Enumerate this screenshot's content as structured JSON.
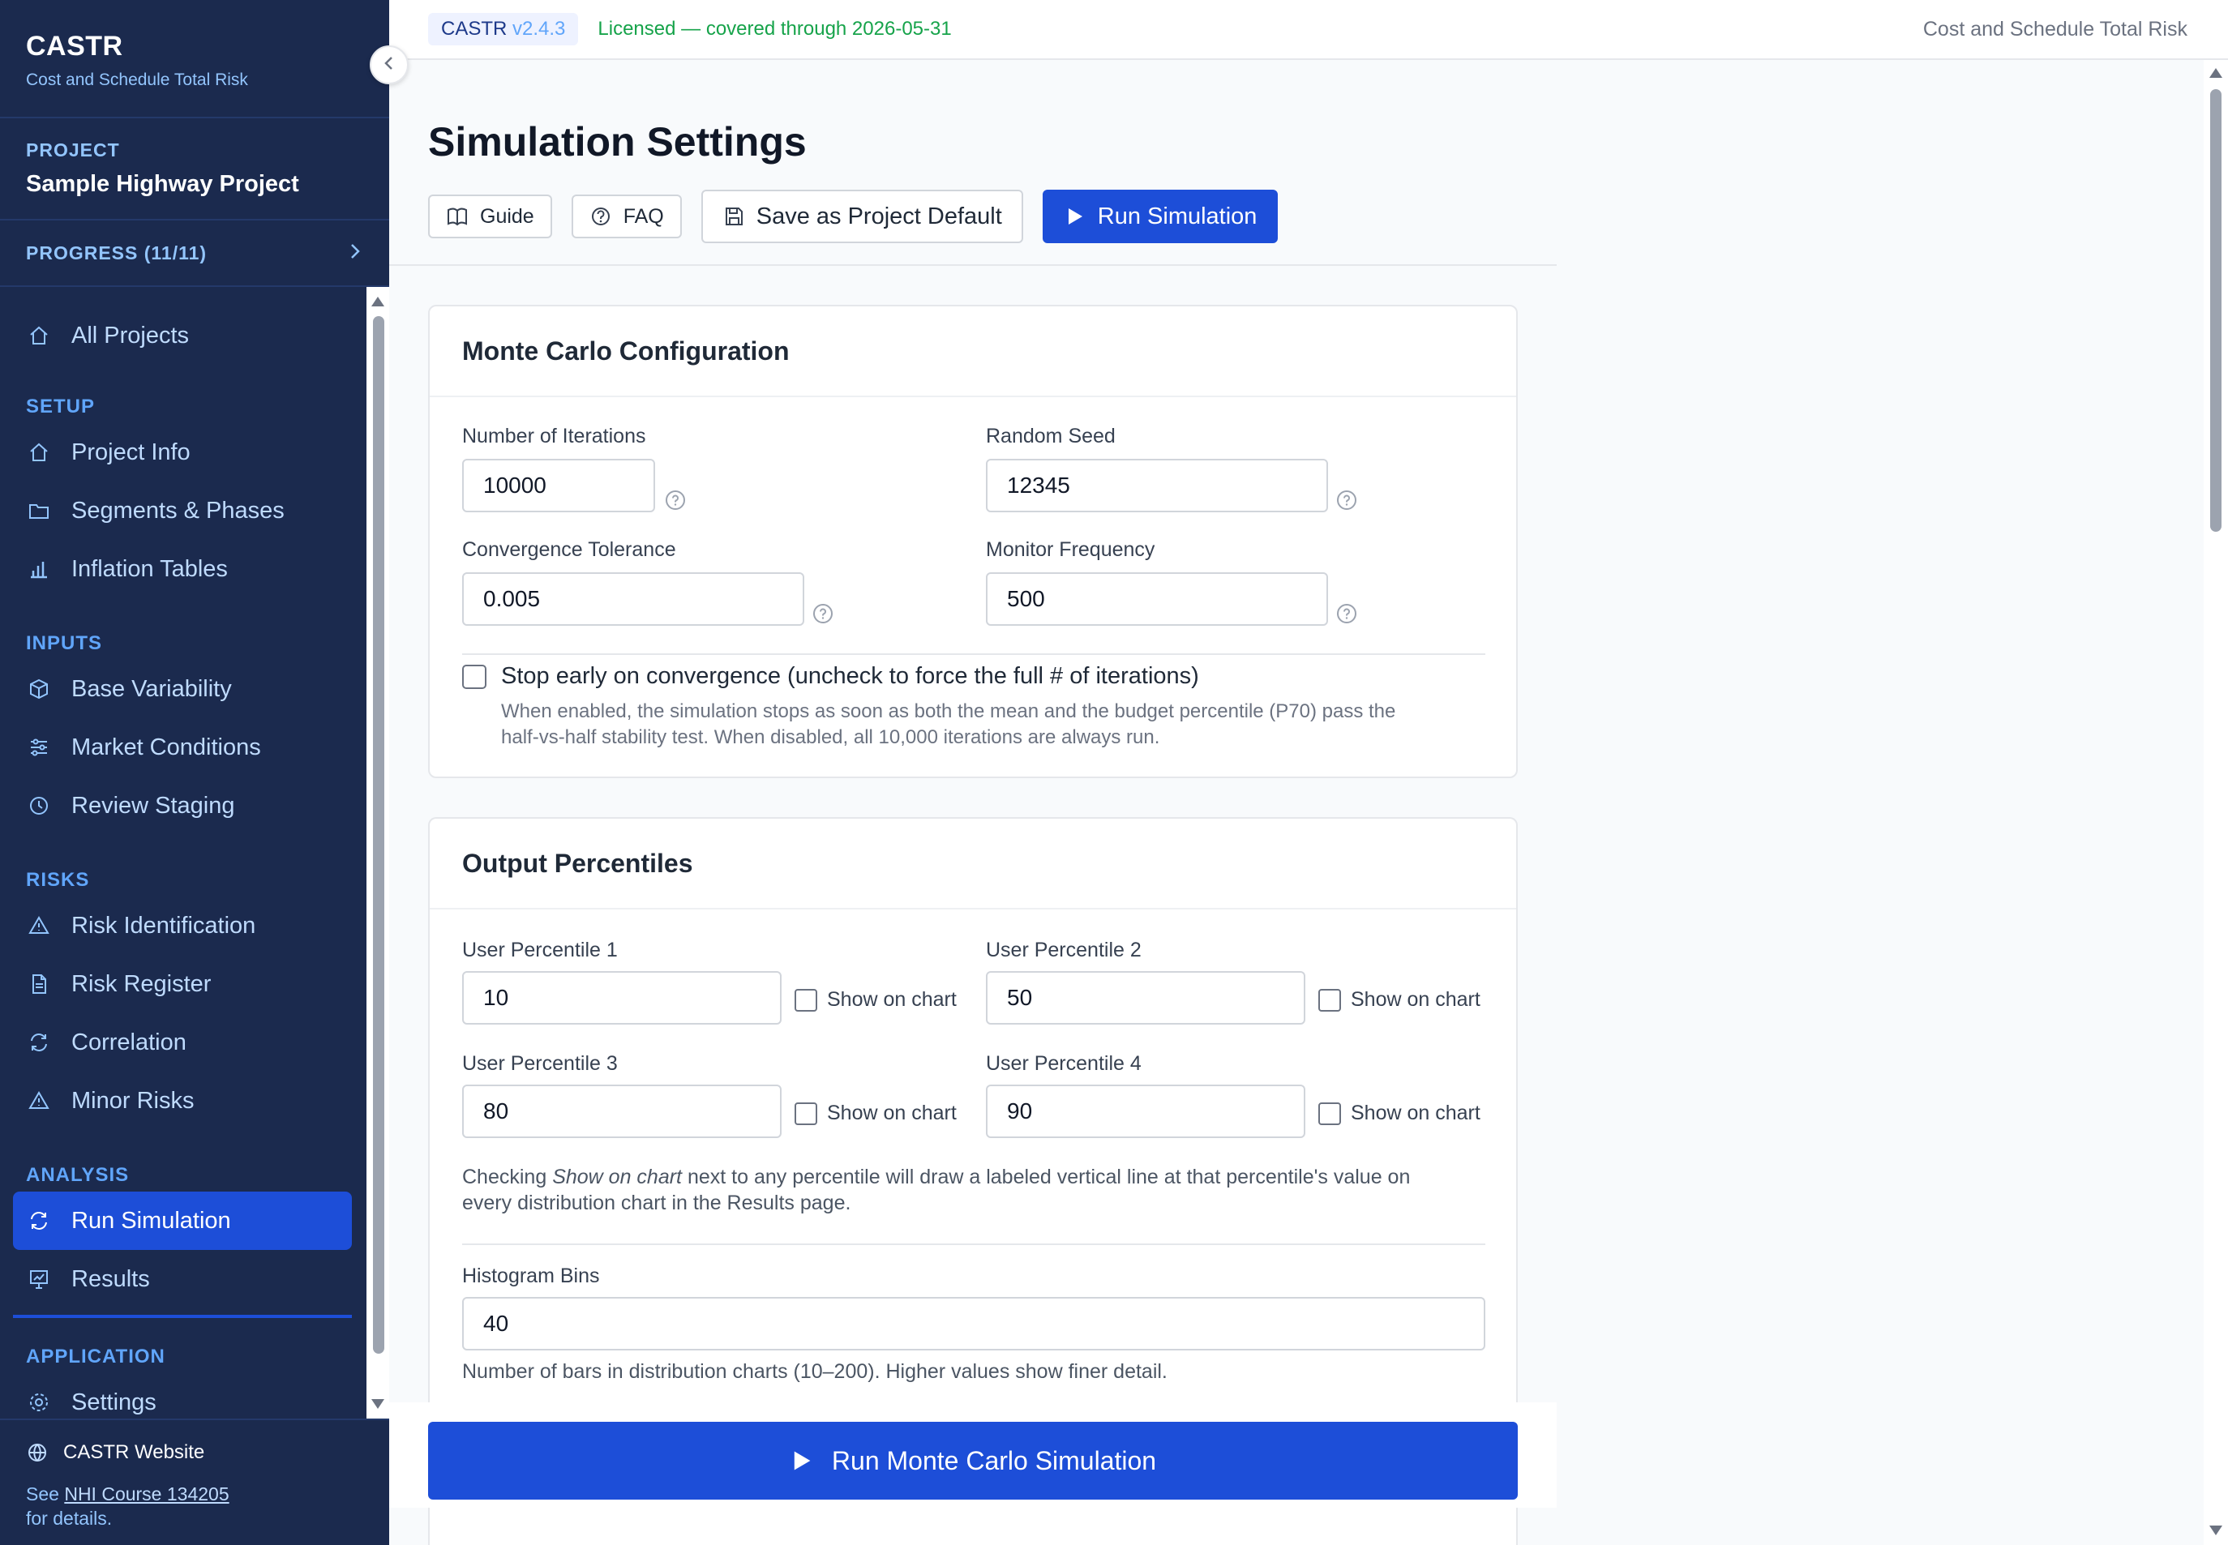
{
  "app": {
    "name": "CASTR",
    "subtitle": "Cost and Schedule Total Risk",
    "version_prefix": "CASTR",
    "version": "v2.4.3",
    "license_status": "Licensed — covered through 2026-05-31",
    "top_right_title": "Cost and Schedule Total Risk"
  },
  "project": {
    "label": "PROJECT",
    "name": "Sample Highway Project",
    "progress_label": "PROGRESS (11/11)"
  },
  "nav": {
    "all_projects": "All Projects",
    "sections": {
      "setup": "SETUP",
      "inputs": "INPUTS",
      "risks": "RISKS",
      "analysis": "ANALYSIS",
      "application": "APPLICATION"
    },
    "items": {
      "project_info": "Project Info",
      "segments_phases": "Segments & Phases",
      "inflation_tables": "Inflation Tables",
      "base_variability": "Base Variability",
      "market_conditions": "Market Conditions",
      "review_staging": "Review Staging",
      "risk_identification": "Risk Identification",
      "risk_register": "Risk Register",
      "correlation": "Correlation",
      "minor_risks": "Minor Risks",
      "run_simulation": "Run Simulation",
      "results": "Results",
      "settings": "Settings"
    },
    "active": "run_simulation"
  },
  "footer": {
    "website": "CASTR Website",
    "note_prefix": "See",
    "note_link": "NHI Course 134205",
    "note_suffix": "for details."
  },
  "page": {
    "title": "Simulation Settings",
    "toolbar": {
      "guide": "Guide",
      "faq": "FAQ",
      "save_default": "Save as Project Default",
      "run": "Run Simulation"
    }
  },
  "monte_carlo": {
    "title": "Monte Carlo Configuration",
    "iterations_label": "Number of Iterations",
    "iterations_value": "10000",
    "seed_label": "Random Seed",
    "seed_value": "12345",
    "tolerance_label": "Convergence Tolerance",
    "tolerance_value": "0.005",
    "monitor_label": "Monitor Frequency",
    "monitor_value": "500",
    "stop_early_label": "Stop early on convergence (uncheck to force the full # of iterations)",
    "stop_early_checked": false,
    "stop_early_hint_1": "When enabled, the simulation stops as soon as both the mean and the budget percentile (P70) pass the",
    "stop_early_hint_2": "half-vs-half stability test. When disabled, all 10,000 iterations are always run."
  },
  "percentiles": {
    "title": "Output Percentiles",
    "show_on_chart": "Show on chart",
    "items": [
      {
        "label": "User Percentile 1",
        "value": "10",
        "show": false
      },
      {
        "label": "User Percentile 2",
        "value": "50",
        "show": false
      },
      {
        "label": "User Percentile 3",
        "value": "80",
        "show": false
      },
      {
        "label": "User Percentile 4",
        "value": "90",
        "show": false
      }
    ],
    "hint_pre": "Checking",
    "hint_em": "Show on chart",
    "hint_post": "next to any percentile will draw a labeled vertical line at that percentile's value on",
    "hint_line2": "every distribution chart in the Results page.",
    "bins_label": "Histogram Bins",
    "bins_value": "40",
    "bins_hint": "Number of bars in distribution charts (10–200). Higher values show finer detail."
  },
  "run_bar": {
    "label": "Run Monte Carlo Simulation"
  }
}
